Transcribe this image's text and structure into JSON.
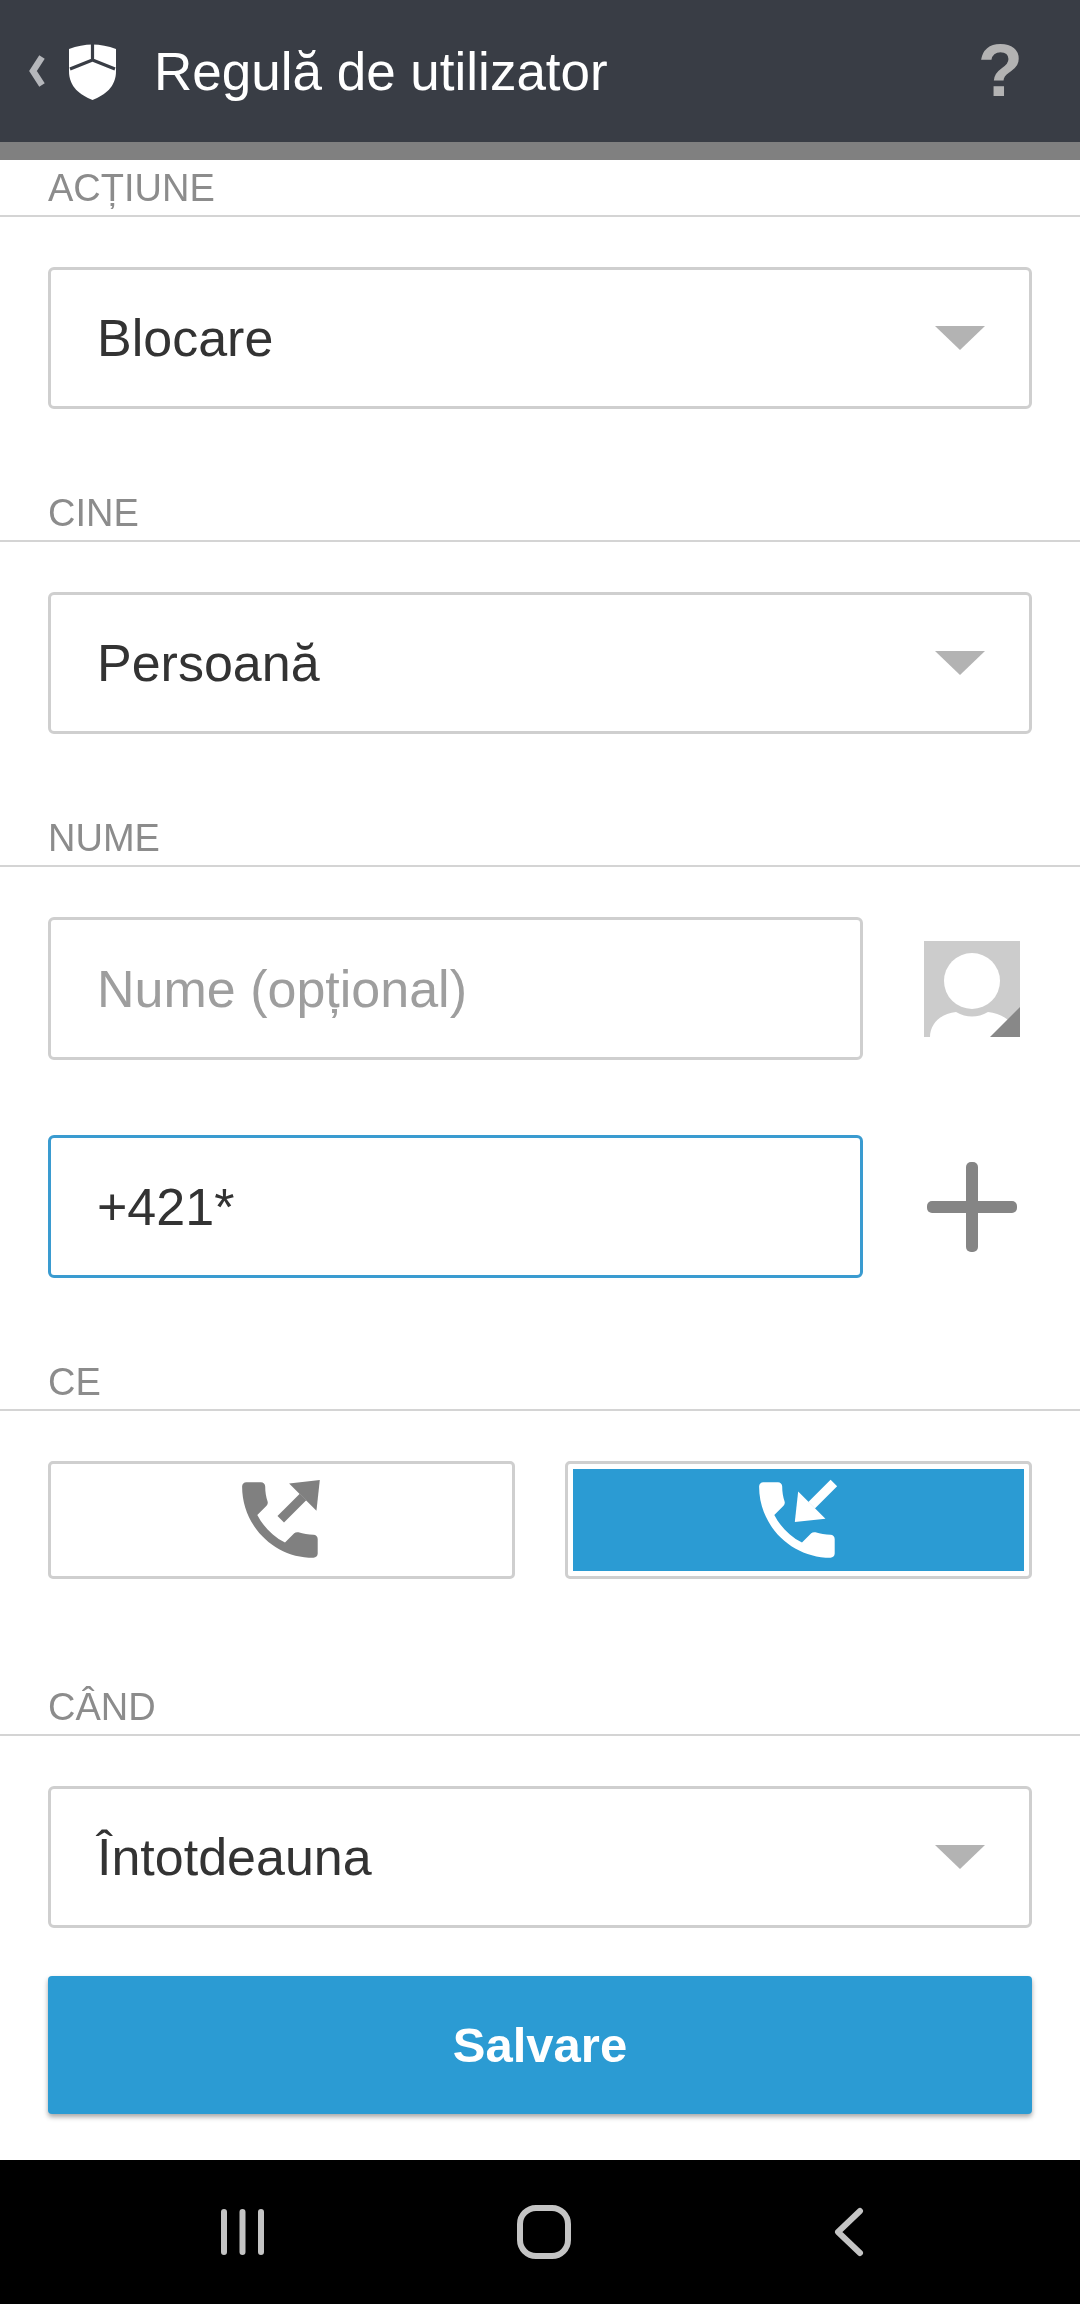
{
  "app_bar": {
    "title": "Regulă de utilizator",
    "help_label": "?"
  },
  "sections": [
    {
      "kind": "dropdown",
      "heading": "ACȚIUNE",
      "value": "Blocare"
    },
    {
      "kind": "dropdown",
      "heading": "CINE",
      "value": "Persoană"
    },
    {
      "kind": "contact",
      "heading": "NUME",
      "fields": [
        {
          "kind": "name",
          "placeholder": "Nume (opțional)",
          "focused": false
        },
        {
          "kind": "number",
          "value": "+421*",
          "focused": true
        }
      ]
    },
    {
      "kind": "direction",
      "heading": "CE",
      "options": [
        {
          "kind": "outgoing",
          "selected": false
        },
        {
          "kind": "incoming",
          "selected": true
        }
      ]
    },
    {
      "kind": "dropdown",
      "heading": "CÂND",
      "value": "Întotdeauna"
    }
  ],
  "save_button": {
    "label": "Salvare"
  }
}
